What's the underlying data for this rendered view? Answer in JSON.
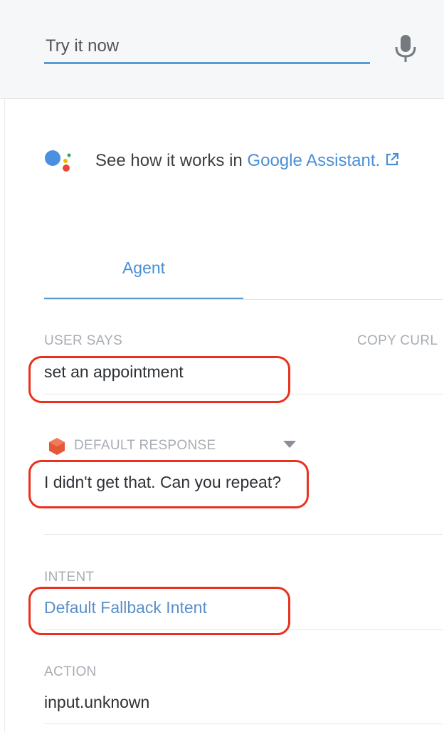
{
  "try_it": {
    "placeholder": "Try it now"
  },
  "assistant": {
    "prefix": "See how it works in ",
    "link_text": "Google Assistant."
  },
  "tabs": [
    {
      "label": "Agent",
      "active": true
    }
  ],
  "user_says": {
    "label": "USER SAYS",
    "value": "set an appointment"
  },
  "copy_curl": "COPY CURL",
  "default_response": {
    "label": "DEFAULT RESPONSE",
    "value": "I didn't get that. Can you repeat?"
  },
  "intent": {
    "label": "INTENT",
    "value": "Default Fallback Intent"
  },
  "action": {
    "label": "ACTION",
    "value": "input.unknown"
  },
  "icons": {
    "mic": "microphone-icon",
    "assistant": "google-assistant-logo",
    "external": "external-link-icon",
    "response": "response-hexagon-icon",
    "caret": "chevron-down-icon"
  },
  "colors": {
    "accent": "#4a8fd6",
    "highlight": "#e8321f",
    "label": "#a8adb3"
  }
}
